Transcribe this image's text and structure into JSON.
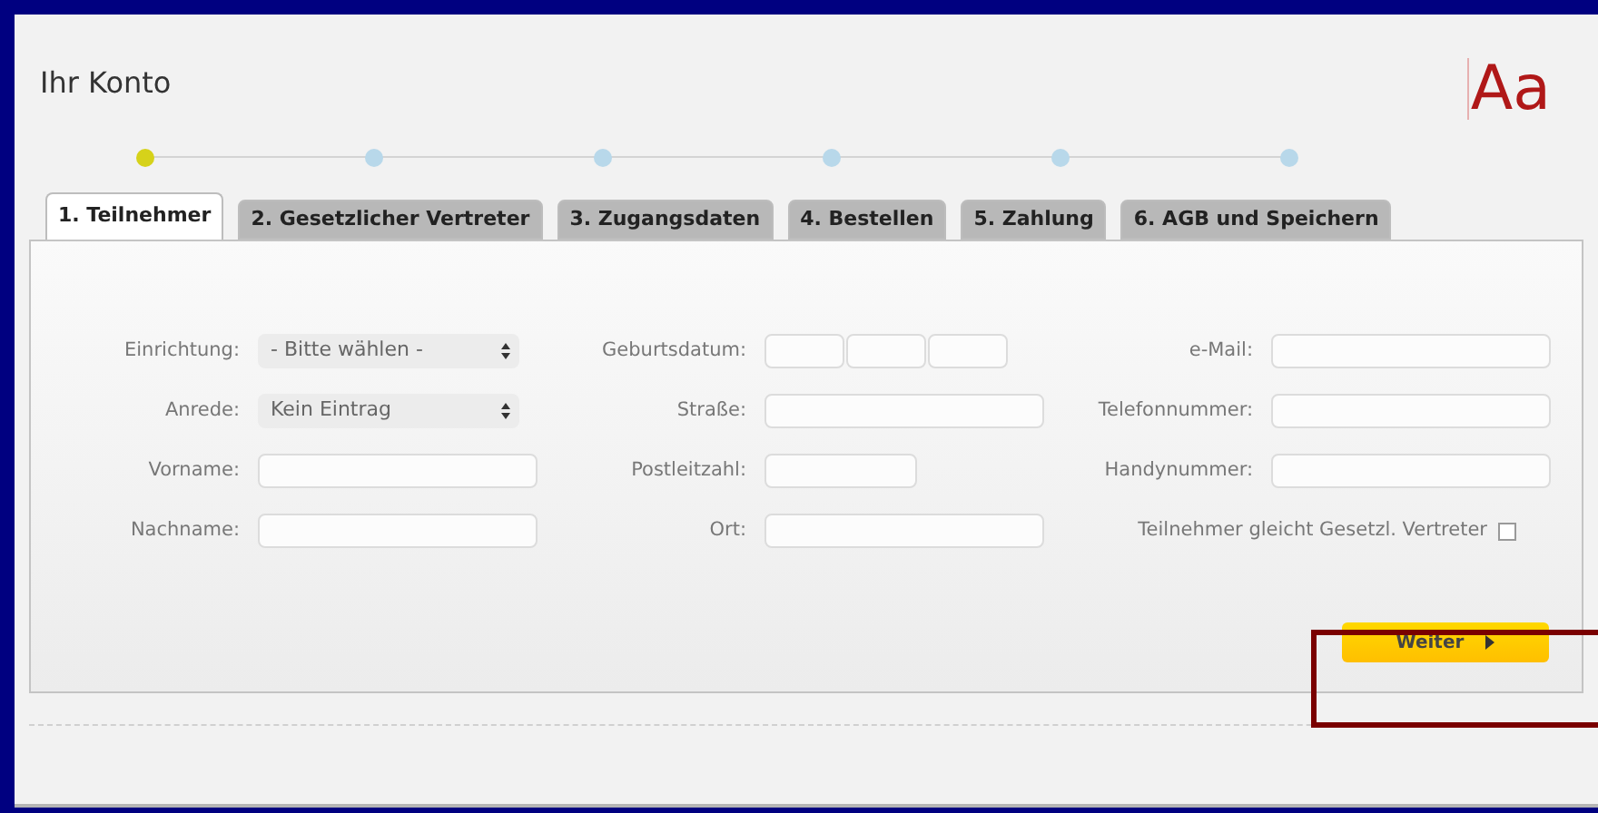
{
  "title": "Ihr Konto",
  "logo": "Aa",
  "steps": [
    {
      "selected": true
    },
    {
      "selected": false
    },
    {
      "selected": false
    },
    {
      "selected": false
    },
    {
      "selected": false
    },
    {
      "selected": false
    }
  ],
  "tabs": [
    {
      "label": "1. Teilnehmer",
      "selected": true
    },
    {
      "label": "2. Gesetzlicher Vertreter",
      "selected": false
    },
    {
      "label": "3. Zugangsdaten",
      "selected": false
    },
    {
      "label": "4. Bestellen",
      "selected": false
    },
    {
      "label": "5. Zahlung",
      "selected": false
    },
    {
      "label": "6. AGB und Speichern",
      "selected": false
    }
  ],
  "columns": [
    [
      {
        "kind": "select",
        "label": "Einrichtung:",
        "value": "- Bitte wählen -"
      },
      {
        "kind": "select",
        "label": "Anrede:",
        "value": "Kein Eintrag"
      },
      {
        "kind": "text",
        "label": "Vorname:"
      },
      {
        "kind": "text",
        "label": "Nachname:"
      }
    ],
    [
      {
        "kind": "date",
        "label": "Geburtsdatum:"
      },
      {
        "kind": "text",
        "label": "Straße:"
      },
      {
        "kind": "short",
        "label": "Postleitzahl:"
      },
      {
        "kind": "text",
        "label": "Ort:"
      }
    ],
    [
      {
        "kind": "text",
        "label": "e-Mail:"
      },
      {
        "kind": "text",
        "label": "Telefonnummer:"
      },
      {
        "kind": "text",
        "label": "Handynummer:"
      },
      {
        "kind": "checkbox",
        "label": "Teilnehmer gleicht Gesetzl. Vertreter",
        "checked": false
      }
    ]
  ],
  "next_button": {
    "label": "Weiter"
  }
}
